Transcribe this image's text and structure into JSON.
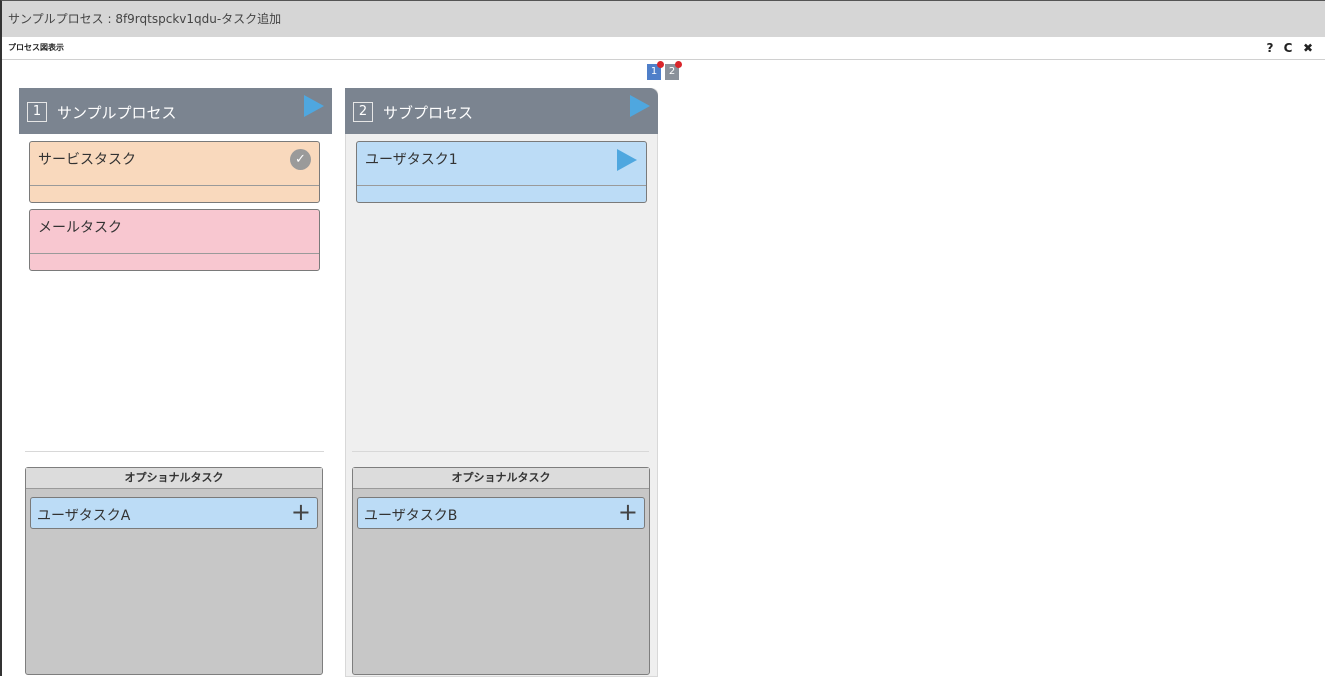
{
  "window": {
    "title": "サンプルプロセス : 8f9rqtspckv1qdu-タスク追加"
  },
  "toolbar": {
    "label": "プロセス図表示",
    "help": "?",
    "refresh": "C",
    "close": "✖"
  },
  "pager": {
    "pages": [
      "1",
      "2"
    ]
  },
  "columns": [
    {
      "number": "1",
      "name": "サンプルプロセス",
      "tasks": [
        {
          "name": "サービスタスク",
          "color": "#f9d9bd",
          "status": "completed-check-icon"
        },
        {
          "name": "メールタスク",
          "color": "#f8c7d0",
          "status": ""
        }
      ],
      "optional": {
        "header": "オプショナルタスク",
        "items": [
          {
            "name": "ユーザタスクA",
            "action": "+"
          }
        ]
      }
    },
    {
      "number": "2",
      "name": "サブプロセス",
      "tasks": [
        {
          "name": "ユーザタスク1",
          "color": "#bcdcf6",
          "status": "play-icon"
        }
      ],
      "optional": {
        "header": "オプショナルタスク",
        "items": [
          {
            "name": "ユーザタスクB",
            "action": "+"
          }
        ]
      }
    }
  ],
  "colors": {
    "header": "#7b8490",
    "accent": "#4fa7df",
    "pager_active": "#4f7fc9",
    "pager_inactive": "#8a919a",
    "badge": "#d9252a"
  }
}
